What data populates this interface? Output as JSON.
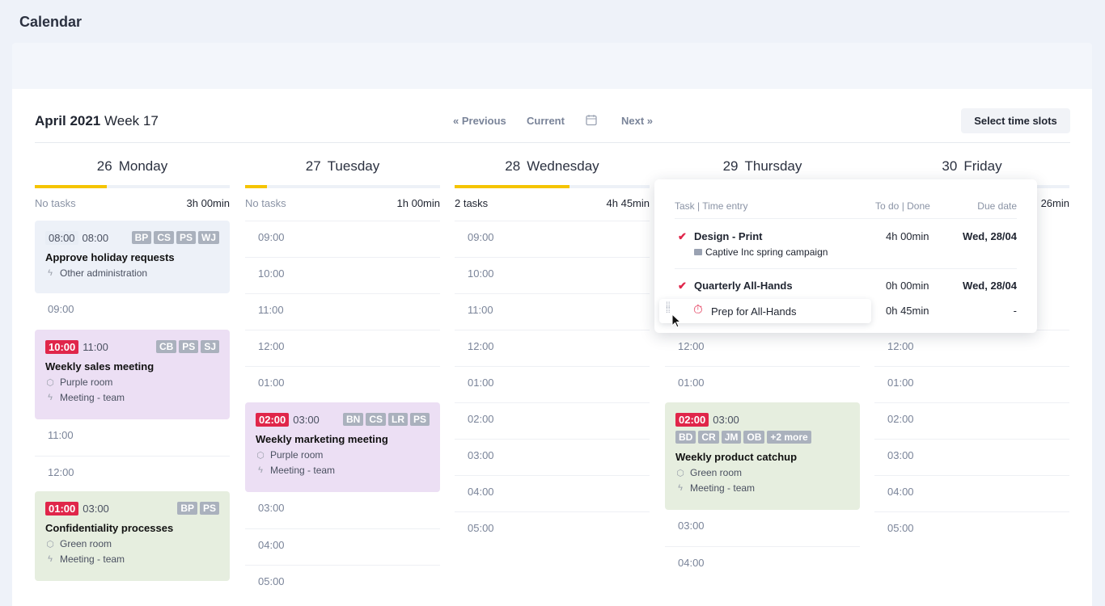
{
  "app_title": "Calendar",
  "header": {
    "month": "April 2021",
    "week": "Week 17",
    "previous": "« Previous",
    "current": "Current",
    "next": "Next »",
    "select_slots": "Select time slots"
  },
  "days": [
    {
      "num": "26",
      "name": "Monday",
      "progress": 0.37,
      "tasks": "No tasks",
      "total": "3h 00min"
    },
    {
      "num": "27",
      "name": "Tuesday",
      "progress": 0.11,
      "tasks": "No tasks",
      "total": "1h 00min"
    },
    {
      "num": "28",
      "name": "Wednesday",
      "progress": 0.59,
      "tasks": "2 tasks",
      "total": "4h 45min"
    },
    {
      "num": "29",
      "name": "Thursday"
    },
    {
      "num": "30",
      "name": "Friday",
      "total": "26min"
    }
  ],
  "events": {
    "mon1": {
      "start": "08:00",
      "end": "08:00",
      "tags": [
        "BP",
        "CS",
        "PS",
        "WJ"
      ],
      "title": "Approve holiday requests",
      "category": "Other administration"
    },
    "mon2": {
      "start": "10:00",
      "end": "11:00",
      "tags": [
        "CB",
        "PS",
        "SJ"
      ],
      "title": "Weekly sales meeting",
      "room": "Purple room",
      "category": "Meeting - team"
    },
    "mon3": {
      "start": "01:00",
      "end": "03:00",
      "tags": [
        "BP",
        "PS"
      ],
      "title": "Confidentiality processes",
      "room": "Green room",
      "category": "Meeting - team"
    },
    "tue1": {
      "start": "02:00",
      "end": "03:00",
      "tags": [
        "BN",
        "CS",
        "LR",
        "PS"
      ],
      "title": "Weekly marketing meeting",
      "room": "Purple room",
      "category": "Meeting - team"
    },
    "thu1": {
      "start": "02:00",
      "end": "03:00",
      "tags": [
        "BD",
        "CR",
        "JM",
        "OB",
        "+2 more"
      ],
      "title": "Weekly product catchup",
      "room": "Green room",
      "category": "Meeting - team"
    }
  },
  "slots": {
    "mon": [
      "09:00",
      "11:00",
      "12:00"
    ],
    "tue": [
      "09:00",
      "10:00",
      "11:00",
      "12:00",
      "01:00",
      "03:00",
      "04:00",
      "05:00"
    ],
    "wed": [
      "09:00",
      "10:00",
      "11:00",
      "12:00",
      "01:00",
      "02:00",
      "03:00",
      "04:00",
      "05:00"
    ],
    "thu": [
      "12:00",
      "01:00",
      "03:00",
      "04:00"
    ],
    "fri": [
      "12:00",
      "01:00",
      "02:00",
      "03:00",
      "04:00",
      "05:00"
    ]
  },
  "popup": {
    "col_task": "Task | Time entry",
    "col_todo": "To do | Done",
    "col_due": "Due date",
    "rows": [
      {
        "title": "Design - Print",
        "project": "Captive Inc spring campaign",
        "todo": "4h 00min",
        "due": "Wed, 28/04"
      },
      {
        "title": "Quarterly All-Hands",
        "todo": "0h 00min",
        "due": "Wed, 28/04"
      },
      {
        "title": "Prep for All-Hands",
        "todo": "0h 45min",
        "due": "-"
      }
    ]
  },
  "colors": {
    "accent_red": "#e0264a",
    "progress_yellow": "#f5c400"
  }
}
